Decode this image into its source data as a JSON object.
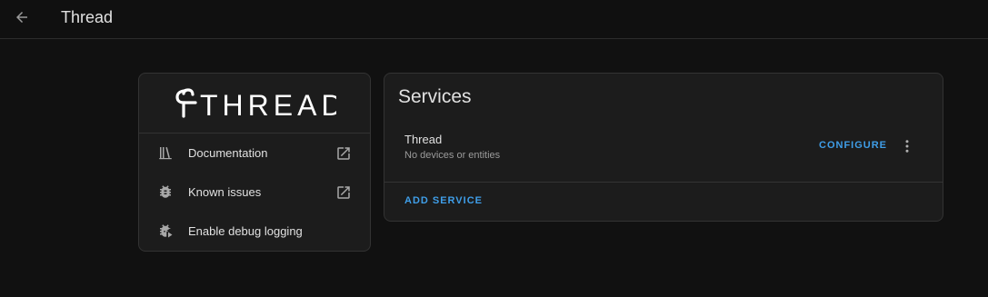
{
  "header": {
    "title": "Thread",
    "back_icon": "arrow-left-icon"
  },
  "integration": {
    "logo_text": "THREAD",
    "links": [
      {
        "label": "Documentation",
        "icon": "book-shelf-icon",
        "external": true
      },
      {
        "label": "Known issues",
        "icon": "bug-icon",
        "external": true
      },
      {
        "label": "Enable debug logging",
        "icon": "bug-play-icon",
        "external": false
      }
    ]
  },
  "services": {
    "title": "Services",
    "items": [
      {
        "name": "Thread",
        "subtitle": "No devices or entities",
        "action": "CONFIGURE"
      }
    ],
    "add_label": "ADD SERVICE"
  },
  "colors": {
    "accent": "#3f9ee8",
    "background": "#111111",
    "card": "#1c1c1c",
    "text": "#e1e1e1",
    "secondary_text": "#9b9b9b"
  }
}
